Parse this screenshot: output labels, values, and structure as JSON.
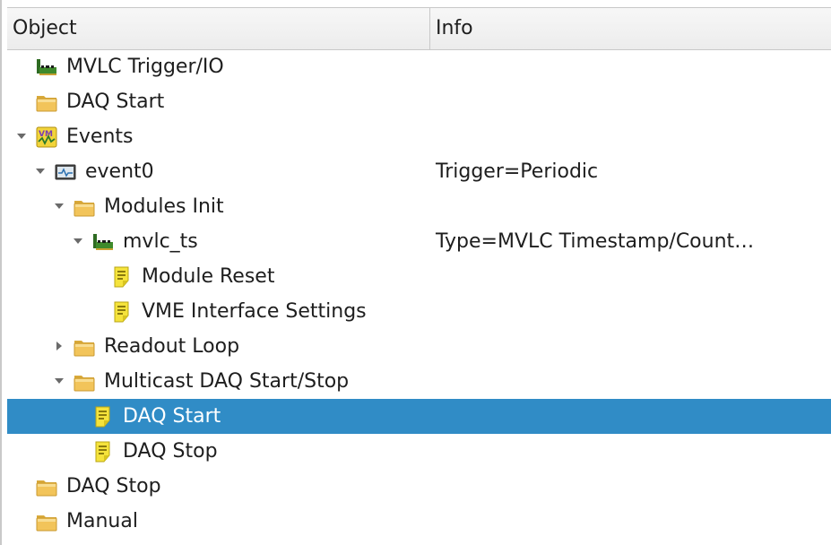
{
  "header": {
    "col_object": "Object",
    "col_info": "Info"
  },
  "tree": [
    {
      "label": "MVLC Trigger/IO",
      "info": "",
      "icon": "vme-module-icon",
      "expand": "none",
      "depth": 0
    },
    {
      "label": "DAQ Start",
      "info": "",
      "icon": "folder-icon",
      "expand": "none",
      "depth": 0
    },
    {
      "label": "Events",
      "info": "",
      "icon": "vme-events-icon",
      "expand": "expanded",
      "depth": 0
    },
    {
      "label": "event0",
      "info": "Trigger=Periodic",
      "icon": "event-icon",
      "expand": "expanded",
      "depth": 1
    },
    {
      "label": "Modules Init",
      "info": "",
      "icon": "folder-icon",
      "expand": "expanded",
      "depth": 2
    },
    {
      "label": "mvlc_ts",
      "info": "Type=MVLC Timestamp/Count…",
      "icon": "vme-module-icon",
      "expand": "expanded",
      "depth": 3
    },
    {
      "label": "Module Reset",
      "info": "",
      "icon": "script-icon",
      "expand": "none",
      "depth": 4
    },
    {
      "label": "VME Interface Settings",
      "info": "",
      "icon": "script-icon",
      "expand": "none",
      "depth": 4
    },
    {
      "label": "Readout Loop",
      "info": "",
      "icon": "folder-icon",
      "expand": "collapsed",
      "depth": 2
    },
    {
      "label": "Multicast DAQ Start/Stop",
      "info": "",
      "icon": "folder-icon",
      "expand": "expanded",
      "depth": 2
    },
    {
      "label": "DAQ Start",
      "info": "",
      "icon": "script-icon",
      "expand": "none",
      "depth": 3,
      "selected": true
    },
    {
      "label": "DAQ Stop",
      "info": "",
      "icon": "script-icon",
      "expand": "none",
      "depth": 3
    },
    {
      "label": "DAQ Stop",
      "info": "",
      "icon": "folder-icon",
      "expand": "none",
      "depth": 0
    },
    {
      "label": "Manual",
      "info": "",
      "icon": "folder-icon",
      "expand": "none",
      "depth": 0
    }
  ],
  "colors": {
    "selection": "#308cc6",
    "folder": "#f2c45a",
    "script": "#f5e33c"
  }
}
